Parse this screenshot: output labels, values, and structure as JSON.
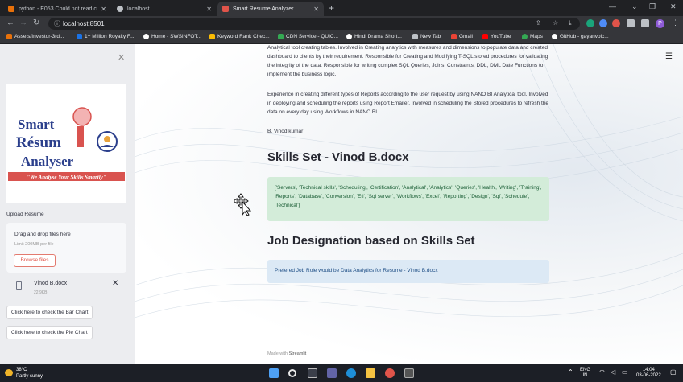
{
  "browser": {
    "tabs": [
      {
        "title": "python - E053 Could not read co",
        "color": "#e8710a"
      },
      {
        "title": "localhost",
        "color": "#bdc1c6"
      },
      {
        "title": "Smart Resume Analyzer",
        "color": "#e0544a"
      }
    ],
    "url": "localhost:8501",
    "bookmarks": [
      {
        "label": "Assets/Investor-3rd...",
        "color": "#e8710a"
      },
      {
        "label": "1+ Million Royalty F...",
        "color": "#1a73e8"
      },
      {
        "label": "Home - SWSINFOT...",
        "color": "#ffffff"
      },
      {
        "label": "Keyword Rank Chec...",
        "color": "#fbbc04"
      },
      {
        "label": "CDN Service - QUIC...",
        "color": "#34a853"
      },
      {
        "label": "Hindi Drama Short...",
        "color": "#ffffff"
      },
      {
        "label": "New Tab",
        "color": "#bdc1c6"
      },
      {
        "label": "Gmail",
        "color": "#ea4335"
      },
      {
        "label": "YouTube",
        "color": "#ff0000"
      },
      {
        "label": "Maps",
        "color": "#34a853"
      },
      {
        "label": "GitHub - gayanvoic...",
        "color": "#ffffff"
      }
    ]
  },
  "sidebar": {
    "logo": {
      "line1": "Smart",
      "line2": "Résum",
      "line3": "Analyser",
      "tagline": "\"We Analyse Your Skills Smartly\""
    },
    "upload_label": "Upload Resume",
    "dropzone_title": "Drag and drop files here",
    "dropzone_limit": "Limit 200MB per file",
    "browse_label": "Browse files",
    "file": {
      "name": "Vinod B.docx",
      "size": "22.9KB"
    },
    "bar_button": "Click here to check the Bar Chart",
    "pie_button": "Click here to check the Pie Chart"
  },
  "main": {
    "intro_paragraph": "Analytical tool creating tables. Involved in Creating analytics with measures and dimensions to populate data and created dashboard to clients by their requirement. Responsible for Creating and Modifying T-SQL stored procedures for validating the integrity of the data. Responsible for writing complex SQL Queries, Joins, Constraints, DDL, DML Date Functions to implement the business logic.",
    "reports_paragraph": "Experience in creating different types of Reports according to the user request by using NANO BI Analytical tool. Involved in deploying and scheduling the reports using Report Emailer. Involved in scheduling the Stored procedures to refresh the data on every day using Workflows in NANO BI.",
    "signature": "B. Vinod kumar",
    "skills_heading": "Skills Set - Vinod B.docx",
    "skills_list": "['Servers', 'Technical skills', 'Scheduling', 'Certification', 'Analytical', 'Analytics', 'Queries', 'Health', 'Writing', 'Training', 'Reports', 'Database', 'Conversion', 'Etl', 'Sql server', 'Workflows', 'Excel', 'Reporting', 'Design', 'Sql', 'Schedule', 'Technical']",
    "job_heading": "Job Designation based on Skills Set",
    "job_result": "Prefered Job Role would be Data Analytics for Resume - Vinod B.docx",
    "footer_prefix": "Made with",
    "footer_brand": "Streamlit"
  },
  "taskbar": {
    "temperature": "38°C",
    "weather": "Partly sunny",
    "lang1": "ENG",
    "lang2": "IN",
    "time": "14:04",
    "date": "03-06-2022"
  }
}
